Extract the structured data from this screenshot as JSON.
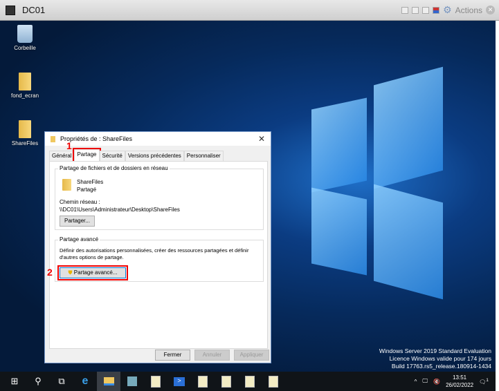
{
  "vm": {
    "title": "DC01",
    "actions": "Actions"
  },
  "desktop": {
    "icons": [
      {
        "label": "Corbeille"
      },
      {
        "label": "fond_ecran"
      },
      {
        "label": "ShareFiles"
      }
    ],
    "watermark": [
      "Windows Server 2019 Standard Evaluation",
      "Licence Windows valide pour 174 jours",
      "Build 17763.rs5_release.180914-1434"
    ]
  },
  "dialog": {
    "title": "Propriétés de : ShareFiles",
    "tabs": [
      "Général",
      "Partage",
      "Sécurité",
      "Versions précédentes",
      "Personnaliser"
    ],
    "group1": {
      "legend": "Partage de fichiers et de dossiers en réseau",
      "name": "ShareFiles",
      "status": "Partagé",
      "path_label": "Chemin réseau :",
      "path": "\\\\DC01\\Users\\Administrateur\\Desktop\\ShareFiles",
      "button": "Partager..."
    },
    "group2": {
      "legend": "Partage avancé",
      "desc1": "Définir des autorisations personnalisées, créer des ressources partagées et définir",
      "desc2": "d'autres options de partage.",
      "button": "Partage avancé..."
    },
    "footer": {
      "close": "Fermer",
      "cancel": "Annuler",
      "apply": "Appliquer"
    },
    "annotations": [
      "1",
      "2"
    ]
  },
  "taskbar": {
    "time": "13:51",
    "date": "26/02/2022",
    "notif_count": "1"
  }
}
